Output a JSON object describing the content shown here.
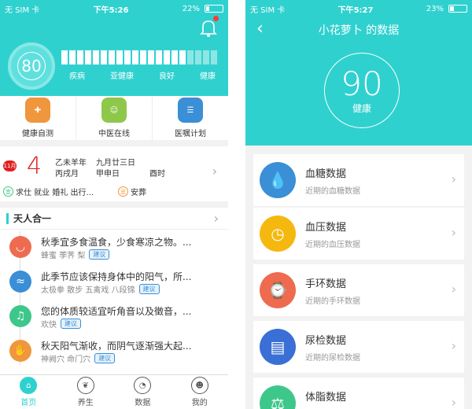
{
  "phone1": {
    "status": {
      "carrier": "无 SIM 卡",
      "time": "下午5:26",
      "battery": "22%",
      "battery_level": 0.22
    },
    "header": {
      "score": "80",
      "levels": [
        "疾病",
        "亚健康",
        "良好",
        "健康"
      ]
    },
    "tools": [
      {
        "label": "健康自测",
        "icon": "stethoscope-icon",
        "color": "#f0963c"
      },
      {
        "label": "中医在线",
        "icon": "doctor-icon",
        "color": "#8ec84a"
      },
      {
        "label": "医嘱计划",
        "icon": "clipboard-icon",
        "color": "#3a8fd6"
      }
    ],
    "calendar": {
      "month": "11月",
      "day": "4",
      "line1a": "乙未羊年",
      "line2a": "丙戌月",
      "line1b": "九月廿三日",
      "line2b": "甲申日",
      "line2c": "酉时",
      "yi_mark": "宜",
      "yi": "求仕 就业 婚礼 出行...",
      "ji_mark": "忌",
      "ji": "安葬"
    },
    "tianren": {
      "title": "天人合一",
      "items": [
        {
          "title": "秋季宜多食温食，少食寒凉之物。...",
          "sub": "蜂蜜 荸荠 梨",
          "tag": "建议",
          "icon": "bowl-icon",
          "color": "#ef6b50"
        },
        {
          "title": "此季节应该保持身体中的阳气，所...",
          "sub": "太极拳 散步 五禽戏 八段锦",
          "tag": "建议",
          "icon": "swim-icon",
          "color": "#3a8fd6"
        },
        {
          "title": "您的体质较适宜听角音以及徵音，...",
          "sub": "欢快",
          "tag": "建议",
          "icon": "music-icon",
          "color": "#3ec78a"
        },
        {
          "title": "秋天阳气渐收，而阴气逐渐强大起...",
          "sub": "神阙穴 命门穴",
          "tag": "建议",
          "icon": "massage-icon",
          "color": "#f0963c"
        }
      ]
    },
    "tabs": [
      {
        "label": "首页",
        "icon": "home-icon"
      },
      {
        "label": "养生",
        "icon": "leaf-icon"
      },
      {
        "label": "数据",
        "icon": "chart-icon"
      },
      {
        "label": "我的",
        "icon": "user-icon"
      }
    ]
  },
  "phone2": {
    "status": {
      "carrier": "无 SIM 卡",
      "time": "下午5:27",
      "battery": "23%",
      "battery_level": 0.23
    },
    "title": "小花萝卜 的数据",
    "score": "90",
    "score_label": "健康",
    "cards": [
      {
        "title": "血糖数据",
        "sub": "近期的血糖数据",
        "icon": "drop-icon",
        "color": "#3a8fd6"
      },
      {
        "title": "血压数据",
        "sub": "近期的血压数据",
        "icon": "gauge-icon",
        "color": "#f5b80f"
      },
      {
        "title": "手环数据",
        "sub": "近期的手环数据",
        "icon": "watch-icon",
        "color": "#ef6b50"
      },
      {
        "title": "尿检数据",
        "sub": "近期的尿检数据",
        "icon": "report-icon",
        "color": "#3a6fd6"
      },
      {
        "title": "体脂数据",
        "sub": "",
        "icon": "scale-icon",
        "color": "#3ec78a"
      }
    ]
  },
  "colors": {
    "accent": "#2fd1cf",
    "red": "#e02020"
  }
}
